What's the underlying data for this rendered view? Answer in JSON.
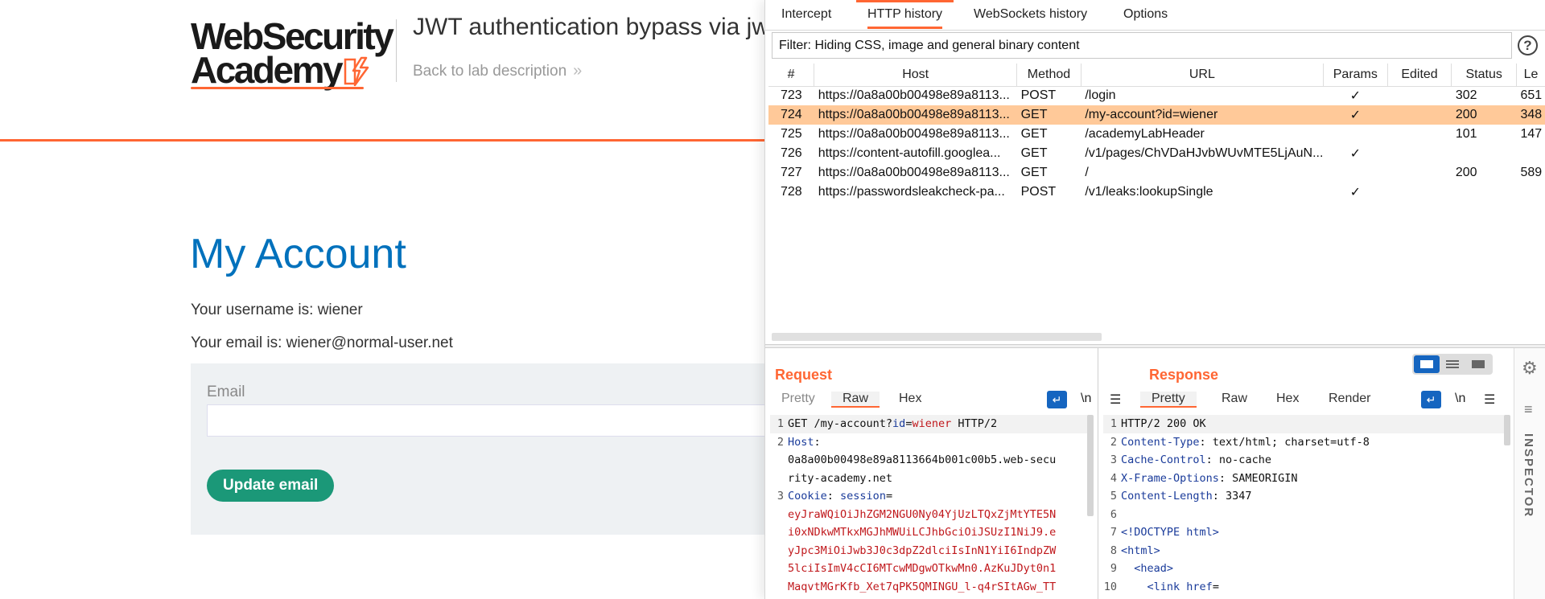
{
  "lab": {
    "logo_line1": "WebSecurity",
    "logo_line2": "Academy",
    "title": "JWT authentication bypass via jw",
    "back_link": "Back to lab description",
    "back_chevron": "»",
    "heading": "My Account",
    "username_line": "Your username is: wiener",
    "email_line": "Your email is: wiener@normal-user.net",
    "email_label": "Email",
    "email_value": "",
    "update_button": "Update email",
    "colors": {
      "accent": "#ff6633",
      "heading": "#0071bc",
      "button": "#1b9878"
    }
  },
  "burp": {
    "tabs": [
      {
        "label": "Intercept"
      },
      {
        "label": "HTTP history"
      },
      {
        "label": "WebSockets history"
      },
      {
        "label": "Options"
      }
    ],
    "active_tab": "HTTP history",
    "filter": "Filter: Hiding CSS, image and general binary content",
    "help_icon": "?",
    "table": {
      "columns": [
        "#",
        "Host",
        "Method",
        "URL",
        "Params",
        "Edited",
        "Status",
        "Le"
      ],
      "rows": [
        {
          "num": "723",
          "host": "https://0a8a00b00498e89a8113...",
          "method": "POST",
          "url": "/login",
          "params": "✓",
          "edited": "",
          "status": "302",
          "length": "651"
        },
        {
          "num": "724",
          "host": "https://0a8a00b00498e89a8113...",
          "method": "GET",
          "url": "/my-account?id=wiener",
          "params": "✓",
          "edited": "",
          "status": "200",
          "length": "348",
          "selected": true
        },
        {
          "num": "725",
          "host": "https://0a8a00b00498e89a8113...",
          "method": "GET",
          "url": "/academyLabHeader",
          "params": "",
          "edited": "",
          "status": "101",
          "length": "147"
        },
        {
          "num": "726",
          "host": "https://content-autofill.googlea...",
          "method": "GET",
          "url": "/v1/pages/ChVDaHJvbWUvMTE5LjAuN...",
          "params": "✓",
          "edited": "",
          "status": "",
          "length": ""
        },
        {
          "num": "727",
          "host": "https://0a8a00b00498e89a8113...",
          "method": "GET",
          "url": "/",
          "params": "",
          "edited": "",
          "status": "200",
          "length": "589"
        },
        {
          "num": "728",
          "host": "https://passwordsleakcheck-pa...",
          "method": "POST",
          "url": "/v1/leaks:lookupSingle",
          "params": "✓",
          "edited": "",
          "status": "",
          "length": ""
        }
      ]
    },
    "request": {
      "title": "Request",
      "tabs": [
        "Pretty",
        "Raw",
        "Hex"
      ],
      "active": "Raw",
      "newline_toggle": "\\n",
      "menu_icon": "☰",
      "lines": [
        {
          "n": "1",
          "parts": [
            [
              "",
              "GET /my-account?"
            ],
            [
              "blue",
              "id"
            ],
            [
              "",
              "="
            ],
            [
              "red",
              "wiener"
            ],
            [
              "",
              " HTTP/2"
            ]
          ]
        },
        {
          "n": "2",
          "parts": [
            [
              "hdr",
              "Host"
            ],
            [
              "",
              ":"
            ]
          ]
        },
        {
          "n": "",
          "parts": [
            [
              "",
              "0a8a00b00498e89a8113664b001c00b5.web-secu"
            ]
          ]
        },
        {
          "n": "",
          "parts": [
            [
              "",
              "rity-academy.net"
            ]
          ]
        },
        {
          "n": "3",
          "parts": [
            [
              "hdr",
              "Cookie"
            ],
            [
              "",
              ": "
            ],
            [
              "blue",
              "session"
            ],
            [
              "",
              "="
            ]
          ]
        },
        {
          "n": "",
          "parts": [
            [
              "red",
              "eyJraWQiOiJhZGM2NGU0Ny04YjUzLTQxZjMtYTE5N"
            ]
          ]
        },
        {
          "n": "",
          "parts": [
            [
              "red",
              "i0xNDkwMTkxMGJhMWUiLCJhbGciOiJSUzI1NiJ9.e"
            ]
          ]
        },
        {
          "n": "",
          "parts": [
            [
              "red",
              "yJpc3MiOiJwb3J0c3dpZ2dlciIsInN1YiI6IndpZW"
            ]
          ]
        },
        {
          "n": "",
          "parts": [
            [
              "red",
              "5lciIsImV4cCI6MTcwMDgwOTkwMn0.AzKuJDyt0n1"
            ]
          ]
        },
        {
          "n": "",
          "parts": [
            [
              "red",
              "MaqvtMGrKfb_Xet7qPK5QMINGU_l-q4rSItAGw_TT"
            ]
          ]
        }
      ]
    },
    "response": {
      "title": "Response",
      "tabs": [
        "Pretty",
        "Raw",
        "Hex",
        "Render"
      ],
      "active": "Pretty",
      "newline_toggle": "\\n",
      "menu_icon": "☰",
      "lines": [
        {
          "n": "1",
          "parts": [
            [
              "",
              "HTTP/2 200 OK"
            ]
          ]
        },
        {
          "n": "2",
          "parts": [
            [
              "hdr",
              "Content-Type"
            ],
            [
              "",
              ": text/html; charset=utf-8"
            ]
          ]
        },
        {
          "n": "3",
          "parts": [
            [
              "hdr",
              "Cache-Control"
            ],
            [
              "",
              ": no-cache"
            ]
          ]
        },
        {
          "n": "4",
          "parts": [
            [
              "hdr",
              "X-Frame-Options"
            ],
            [
              "",
              ": SAMEORIGIN"
            ]
          ]
        },
        {
          "n": "5",
          "parts": [
            [
              "hdr",
              "Content-Length"
            ],
            [
              "",
              ": 3347"
            ]
          ]
        },
        {
          "n": "6",
          "parts": [
            [
              "",
              ""
            ]
          ]
        },
        {
          "n": "7",
          "parts": [
            [
              "hdr",
              "<!DOCTYPE html>"
            ]
          ]
        },
        {
          "n": "8",
          "parts": [
            [
              "hdr",
              "<html>"
            ]
          ]
        },
        {
          "n": "9",
          "parts": [
            [
              "",
              "  "
            ],
            [
              "hdr",
              "<head>"
            ]
          ]
        },
        {
          "n": "10",
          "parts": [
            [
              "",
              "    "
            ],
            [
              "hdr",
              "<link "
            ],
            [
              "blue",
              "href"
            ],
            [
              "",
              "="
            ]
          ]
        }
      ]
    },
    "inspector_label": "INSPECTOR",
    "settings_icon": "⚙",
    "inspector_list_icon": "≡"
  }
}
